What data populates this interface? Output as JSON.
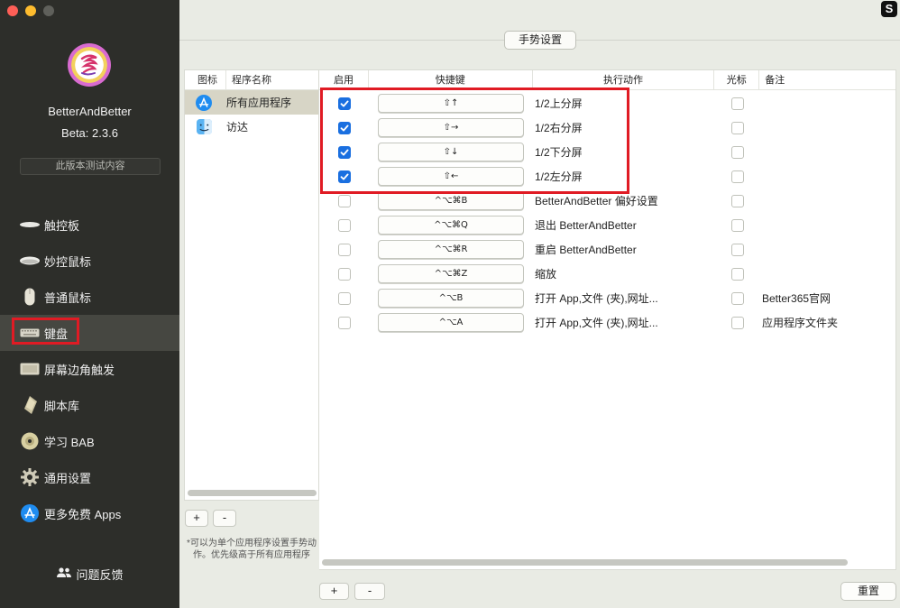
{
  "app": {
    "name": "BetterAndBetter",
    "version": "Beta: 2.3.6",
    "beta_note": "此版本测试内容"
  },
  "colors": {
    "sidebar_bg": "#2d2e2a",
    "accent_blue": "#1a6fe0",
    "highlight_red": "#e01b24"
  },
  "sidebar": {
    "items": [
      {
        "label": "触控板",
        "icon": "trackpad-icon"
      },
      {
        "label": "妙控鼠标",
        "icon": "magic-mouse-icon"
      },
      {
        "label": "普通鼠标",
        "icon": "mouse-icon"
      },
      {
        "label": "键盘",
        "icon": "keyboard-icon",
        "active": true
      },
      {
        "label": "屏幕边角触发",
        "icon": "screen-corner-icon"
      },
      {
        "label": "脚本库",
        "icon": "script-icon"
      },
      {
        "label": "学习 BAB",
        "icon": "disc-icon"
      },
      {
        "label": "通用设置",
        "icon": "gear-icon"
      },
      {
        "label": "更多免费 Apps",
        "icon": "app-store-icon"
      }
    ],
    "feedback_label": "问题反馈"
  },
  "toolbar": {
    "gesture_settings": "手势设置",
    "top_right_logo": "S"
  },
  "app_list": {
    "headers": {
      "icon": "图标",
      "name": "程序名称"
    },
    "rows": [
      {
        "name": "所有应用程序",
        "icon": "app-store-icon",
        "selected": true
      },
      {
        "name": "访达",
        "icon": "finder-icon",
        "selected": false
      }
    ],
    "add_label": "+",
    "remove_label": "-",
    "note": "*可以为单个应用程序设置手势动作。优先级高于所有应用程序"
  },
  "shortcut_table": {
    "headers": {
      "enabled": "启用",
      "shortcut": "快捷键",
      "action": "执行动作",
      "cursor": "光标",
      "note": "备注"
    },
    "rows": [
      {
        "enabled": true,
        "shortcut": "⇧↑",
        "action": "1/2上分屏",
        "cursor": false,
        "note": ""
      },
      {
        "enabled": true,
        "shortcut": "⇧→",
        "action": "1/2右分屏",
        "cursor": false,
        "note": ""
      },
      {
        "enabled": true,
        "shortcut": "⇧↓",
        "action": "1/2下分屏",
        "cursor": false,
        "note": ""
      },
      {
        "enabled": true,
        "shortcut": "⇧←",
        "action": "1/2左分屏",
        "cursor": false,
        "note": ""
      },
      {
        "enabled": false,
        "shortcut": "^⌥⌘B",
        "action": "BetterAndBetter 偏好设置",
        "cursor": false,
        "note": ""
      },
      {
        "enabled": false,
        "shortcut": "^⌥⌘Q",
        "action": "退出 BetterAndBetter",
        "cursor": false,
        "note": ""
      },
      {
        "enabled": false,
        "shortcut": "^⌥⌘R",
        "action": "重启 BetterAndBetter",
        "cursor": false,
        "note": ""
      },
      {
        "enabled": false,
        "shortcut": "^⌥⌘Z",
        "action": "缩放",
        "cursor": false,
        "note": ""
      },
      {
        "enabled": false,
        "shortcut": "^⌥B",
        "action": "打开 App,文件 (夹),网址...",
        "cursor": false,
        "note": "Better365官网"
      },
      {
        "enabled": false,
        "shortcut": "^⌥A",
        "action": "打开 App,文件 (夹),网址...",
        "cursor": false,
        "note": "应用程序文件夹"
      }
    ],
    "add_label": "+",
    "remove_label": "-",
    "reset_label": "重置"
  }
}
